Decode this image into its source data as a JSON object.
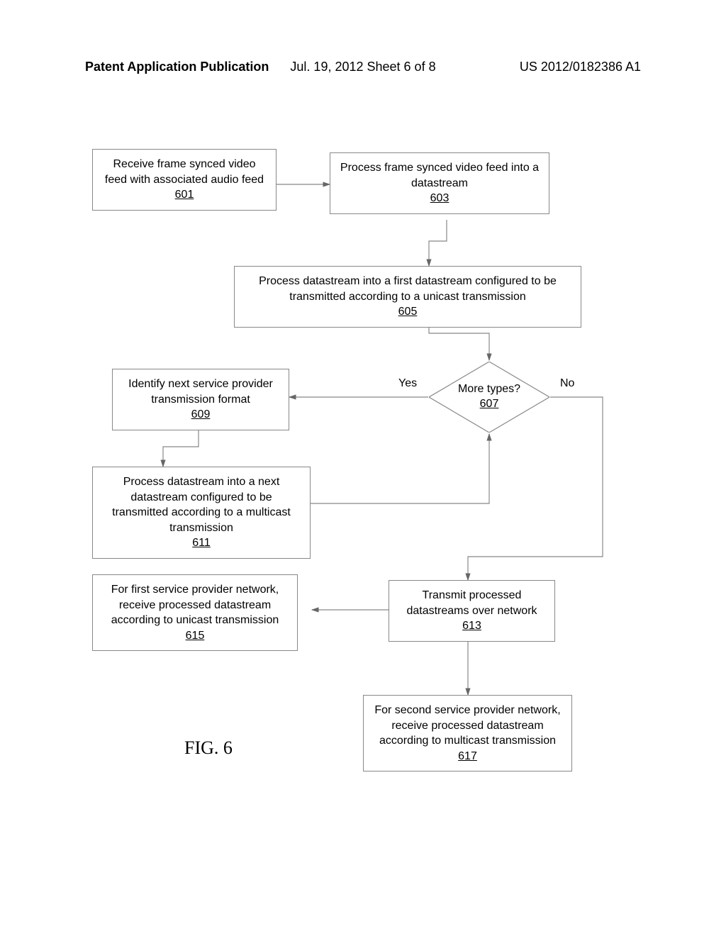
{
  "header": {
    "left": "Patent Application Publication",
    "center": "Jul. 19, 2012  Sheet 6 of 8",
    "right": "US 2012/0182386 A1"
  },
  "boxes": {
    "b601": {
      "text": "Receive frame synced video feed with associated audio feed",
      "ref": "601"
    },
    "b603": {
      "text": "Process frame synced video feed into a datastream",
      "ref": "603"
    },
    "b605": {
      "text": "Process datastream into a first datastream configured to be transmitted according to a unicast transmission",
      "ref": "605"
    },
    "b607": {
      "text": "More types?",
      "ref": "607"
    },
    "b609": {
      "text": "Identify next service provider transmission format",
      "ref": "609"
    },
    "b611": {
      "text": "Process datastream into a next datastream configured to be transmitted according to a multicast transmission",
      "ref": "611"
    },
    "b613": {
      "text": "Transmit processed datastreams over network",
      "ref": "613"
    },
    "b615": {
      "text": "For first service provider network, receive processed datastream according to unicast transmission",
      "ref": "615"
    },
    "b617": {
      "text": "For second service provider network, receive processed datastream according to multicast transmission",
      "ref": "617"
    }
  },
  "labels": {
    "yes": "Yes",
    "no": "No"
  },
  "figure": "FIG. 6"
}
